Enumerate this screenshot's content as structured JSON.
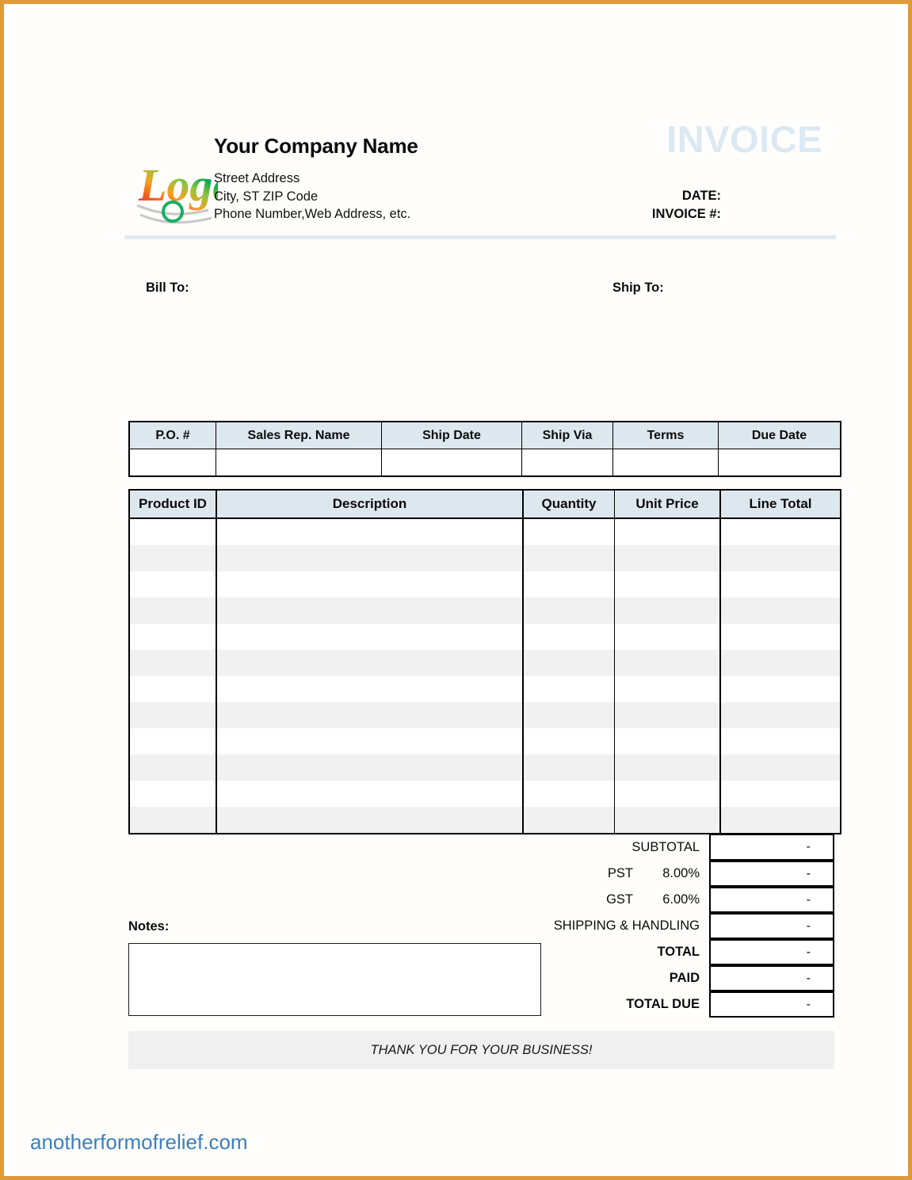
{
  "document": {
    "type": "invoice-template",
    "title_word": "INVOICE",
    "accent_border_color": "#e09a38",
    "header_fill_color": "#dde7ee",
    "invoice_word_color": "#dce9f2"
  },
  "company": {
    "logo_alt": "Logo",
    "name": "Your Company Name",
    "address_line1": "Street Address",
    "address_line2": "City, ST  ZIP Code",
    "address_line3": "Phone Number,Web Address, etc."
  },
  "meta": {
    "date_label": "DATE:",
    "invoice_number_label": "INVOICE #:",
    "date_value": "",
    "invoice_number_value": ""
  },
  "parties": {
    "bill_to_label": "Bill To:",
    "bill_to_value": "",
    "ship_to_label": "Ship To:",
    "ship_to_value": ""
  },
  "order_table": {
    "headers": [
      "P.O. #",
      "Sales Rep. Name",
      "Ship Date",
      "Ship Via",
      "Terms",
      "Due Date"
    ],
    "rows": [
      [
        "",
        "",
        "",
        "",
        "",
        ""
      ]
    ]
  },
  "items_table": {
    "headers": [
      "Product ID",
      "Description",
      "Quantity",
      "Unit Price",
      "Line Total"
    ],
    "row_count": 12,
    "rows": [
      [
        "",
        "",
        "",
        "",
        ""
      ],
      [
        "",
        "",
        "",
        "",
        ""
      ],
      [
        "",
        "",
        "",
        "",
        ""
      ],
      [
        "",
        "",
        "",
        "",
        ""
      ],
      [
        "",
        "",
        "",
        "",
        ""
      ],
      [
        "",
        "",
        "",
        "",
        ""
      ],
      [
        "",
        "",
        "",
        "",
        ""
      ],
      [
        "",
        "",
        "",
        "",
        ""
      ],
      [
        "",
        "",
        "",
        "",
        ""
      ],
      [
        "",
        "",
        "",
        "",
        ""
      ],
      [
        "",
        "",
        "",
        "",
        ""
      ],
      [
        "",
        "",
        "",
        "",
        ""
      ]
    ]
  },
  "totals": [
    {
      "name": "SUBTOTAL",
      "rate": "",
      "value": "-",
      "bold": false
    },
    {
      "name": "PST",
      "rate": "8.00%",
      "value": "-",
      "bold": false
    },
    {
      "name": "GST",
      "rate": "6.00%",
      "value": "-",
      "bold": false
    },
    {
      "name": "SHIPPING & HANDLING",
      "rate": "",
      "value": "-",
      "bold": false
    },
    {
      "name": "TOTAL",
      "rate": "",
      "value": "-",
      "bold": true
    },
    {
      "name": "PAID",
      "rate": "",
      "value": "-",
      "bold": true
    },
    {
      "name": "TOTAL DUE",
      "rate": "",
      "value": "-",
      "bold": true
    }
  ],
  "notes": {
    "label": "Notes:",
    "value": ""
  },
  "footer": {
    "thank_you": "THANK YOU FOR YOUR BUSINESS!"
  },
  "watermark": {
    "text": "anotherformofrelief.com",
    "color": "#3a7ebf"
  }
}
